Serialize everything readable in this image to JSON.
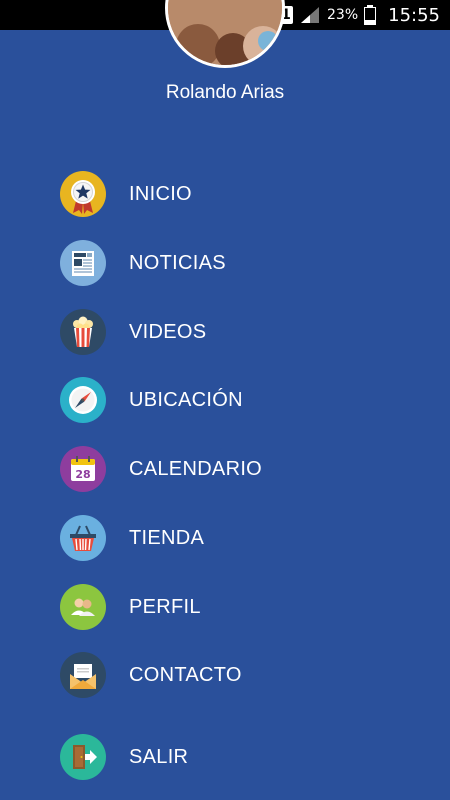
{
  "status_bar": {
    "sim": "1",
    "battery": "23%",
    "time": "15:55"
  },
  "profile": {
    "name": "Rolando Arias"
  },
  "menu": {
    "items": [
      {
        "label": "INICIO",
        "icon": "medal-star-icon",
        "color": "#e8b520"
      },
      {
        "label": "NOTICIAS",
        "icon": "newspaper-icon",
        "color": "#7fb0dd"
      },
      {
        "label": "VIDEOS",
        "icon": "popcorn-icon",
        "color": "#2e4a66"
      },
      {
        "label": "UBICACIÓN",
        "icon": "compass-icon",
        "color": "#2bb1c9"
      },
      {
        "label": "CALENDARIO",
        "icon": "calendar-icon",
        "color": "#8e3d9e"
      },
      {
        "label": "TIENDA",
        "icon": "shopping-basket-icon",
        "color": "#6ab0e0"
      },
      {
        "label": "PERFIL",
        "icon": "users-icon",
        "color": "#8cc63f"
      },
      {
        "label": "CONTACTO",
        "icon": "envelope-icon",
        "color": "#2e4a66"
      },
      {
        "label": "SALIR",
        "icon": "exit-door-icon",
        "color": "#2bb89a"
      }
    ]
  },
  "calendar_day": "28"
}
